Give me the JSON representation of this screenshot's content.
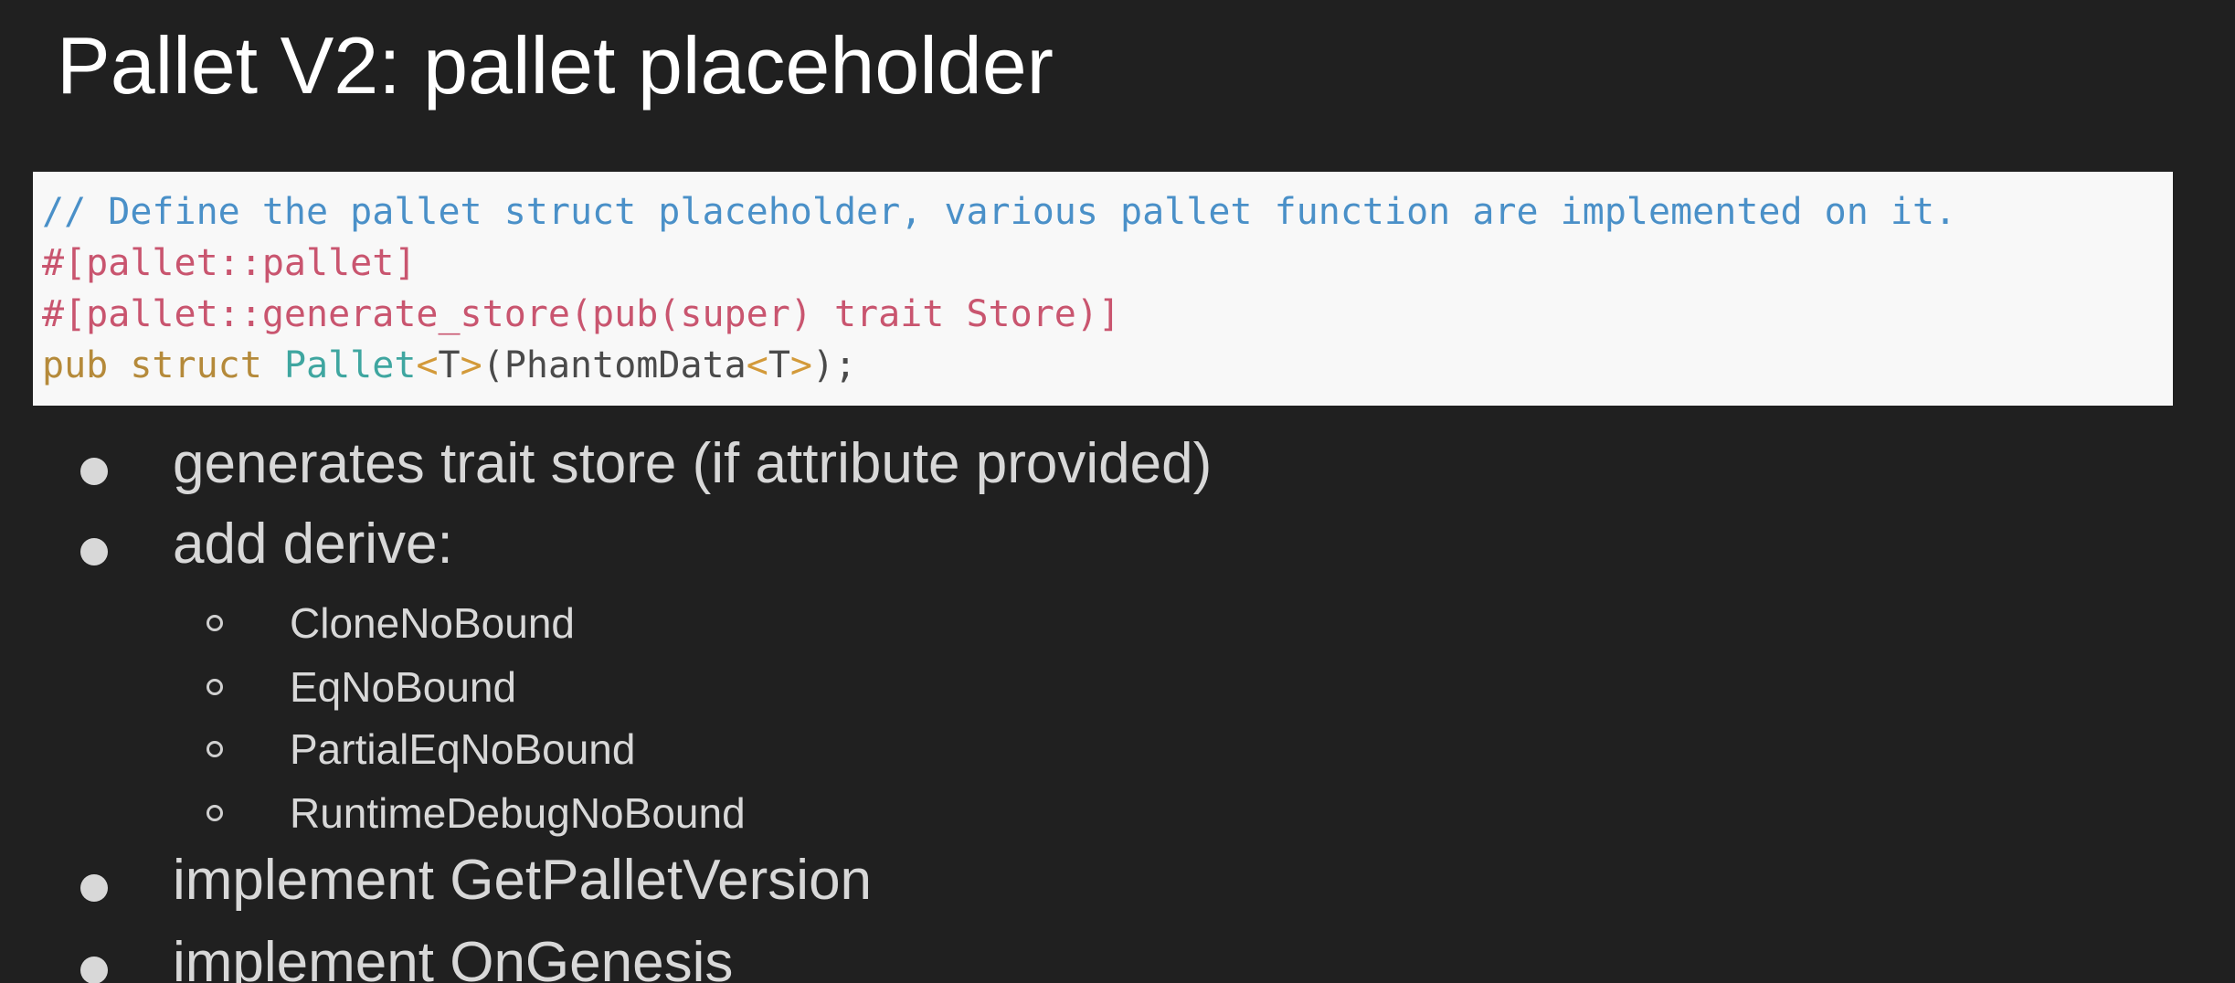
{
  "slide": {
    "title": "Pallet V2: pallet placeholder"
  },
  "code": {
    "line1": "// Define the pallet struct placeholder, various pallet function are implemented on it.",
    "line2": "#[pallet::pallet]",
    "line3": "#[pallet::generate_store(pub(super) trait Store)]",
    "line4": {
      "kw1": "pub",
      "kw2": "struct",
      "type_name": "Pallet",
      "lt1": "<",
      "generic1": "T",
      "gt1": ">",
      "open": "(",
      "inner": "PhantomData",
      "lt2": "<",
      "generic2": "T",
      "gt2": ">",
      "close": ");"
    }
  },
  "bullets": {
    "b1": "generates trait store (if attribute provided)",
    "b2": "add derive:",
    "sub1": "CloneNoBound",
    "sub2": "EqNoBound",
    "sub3": "PartialEqNoBound",
    "sub4": "RuntimeDebugNoBound",
    "b3": "implement GetPalletVersion",
    "b4": "implement OnGenesis"
  },
  "colors": {
    "background": "#202020",
    "code_background": "#f8f8f8",
    "comment": "#4a90c8",
    "attribute": "#c9556f",
    "keyword": "#b58a3a",
    "type": "#3fa6a0",
    "text": "#d8d8d8"
  }
}
